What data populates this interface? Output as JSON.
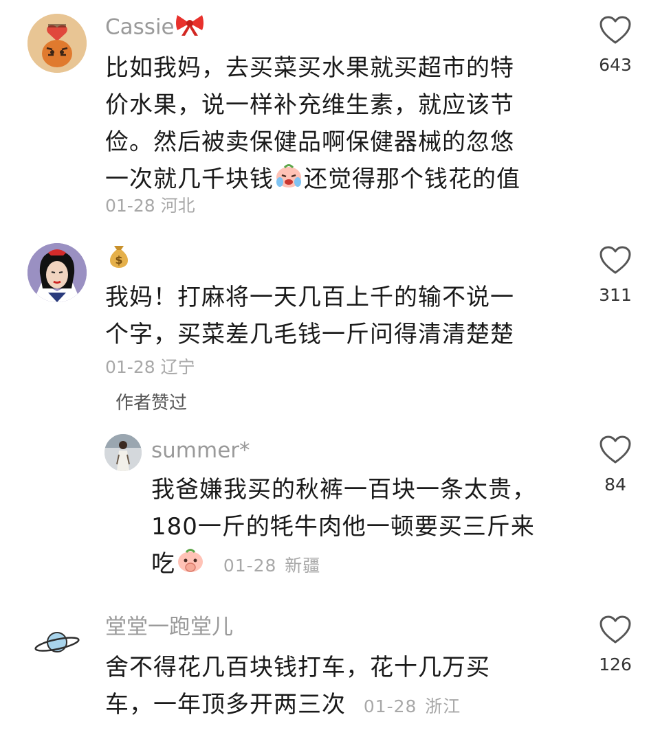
{
  "comments": [
    {
      "username": "Cassie",
      "username_emoji": "ribbon-emoji",
      "lines": [
        "比如我妈，去买菜买水果就买超市的特",
        "价水果，说一样补充维生素，就应该节",
        "俭。然后被卖保健品啊保健器械的忽悠"
      ],
      "line4_before": "一次就几千块钱",
      "line4_emoji": "crying-peach-emoji",
      "line4_after": "还觉得那个钱花的值",
      "date": "01-28",
      "location": "河北",
      "likes": "643"
    },
    {
      "username": "",
      "username_emoji": "money-bag-emoji",
      "lines": [
        "我妈！打麻将一天几百上千的输不说一",
        "个字，买菜差几毛钱一斤问得清清楚楚"
      ],
      "date": "01-28",
      "location": "辽宁",
      "likes": "311",
      "author_liked": "作者赞过"
    },
    {
      "username": "summer*",
      "lines": [
        "我爸嫌我买的秋裤一百块一条太贵，",
        "180一斤的牦牛肉他一顿要买三斤来"
      ],
      "line3_text": "吃",
      "line3_emoji": "shy-peach-emoji",
      "date": "01-28",
      "location": "新疆",
      "likes": "84"
    },
    {
      "username": "堂堂一跑堂儿",
      "lines": [
        "舍不得花几百块钱打车，花十几万买"
      ],
      "line2_text": "车，一年顶多开两三次",
      "date": "01-28",
      "location": "浙江",
      "likes": "126"
    }
  ],
  "icons": {
    "like": "heart-outline-icon"
  },
  "colors": {
    "text": "#1a1a1a",
    "username": "#9a9a9a",
    "meta": "#a8a8a8"
  }
}
